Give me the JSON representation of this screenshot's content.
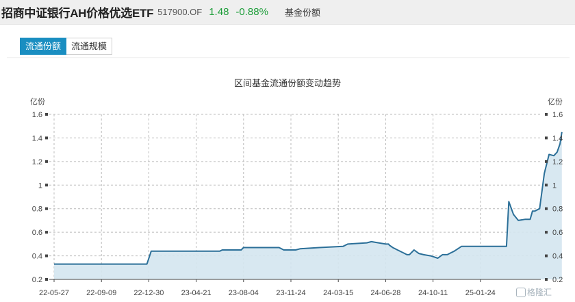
{
  "header": {
    "fund_name": "招商中证银行AH价格优选ETF",
    "fund_code": "517900.OF",
    "price": "1.48",
    "change": "-0.88%",
    "section_label": "基金份额"
  },
  "tabs": [
    {
      "label": "流通份额",
      "active": true
    },
    {
      "label": "流通规模",
      "active": false
    }
  ],
  "watermark": "格隆汇",
  "colors": {
    "accent": "#1a8ec1",
    "line": "#2b6f98",
    "area": "#d4e6ef",
    "up_down": "#1e9e3a"
  },
  "chart_data": {
    "type": "area",
    "title": "区间基金流通份额变动趋势",
    "y_unit_left": "亿份",
    "y_unit_right": "亿份",
    "ylim": [
      0.2,
      1.6
    ],
    "yticks": [
      "0.2",
      "0.4",
      "0.6",
      "0.8",
      "1",
      "1.2",
      "1.4",
      "1.6"
    ],
    "xticks": [
      "22-05-27",
      "22-09-09",
      "22-12-30",
      "23-04-21",
      "23-08-04",
      "23-11-24",
      "24-03-15",
      "24-06-28",
      "24-10-11",
      "25-01-24"
    ],
    "xlim_index": [
      0,
      10.7
    ],
    "grid": true,
    "series": [
      {
        "x": [
          0,
          0.95,
          1.96,
          2.05,
          3.5,
          3.55,
          3.95,
          4.0,
          4.75,
          4.85,
          5.1,
          5.2,
          5.6,
          6.1,
          6.2,
          6.6,
          6.7,
          7.0,
          7.06,
          7.08,
          7.15,
          7.25,
          7.4,
          7.45,
          7.5,
          7.6,
          7.7,
          7.8,
          7.95,
          8.1,
          8.2,
          8.3,
          8.35,
          8.45,
          8.6,
          8.65,
          8.75,
          8.85,
          8.95,
          9.05,
          9.1,
          9.2,
          9.25,
          9.3,
          9.4,
          9.5,
          9.55,
          9.6,
          9.7,
          9.8,
          9.95,
          10.05,
          10.1,
          10.15,
          10.25,
          10.35,
          10.45,
          10.55,
          10.62,
          10.68,
          10.72
        ],
        "y": [
          0.33,
          0.33,
          0.33,
          0.44,
          0.44,
          0.45,
          0.45,
          0.47,
          0.47,
          0.45,
          0.45,
          0.46,
          0.47,
          0.48,
          0.5,
          0.51,
          0.52,
          0.5,
          0.5,
          0.49,
          0.47,
          0.45,
          0.42,
          0.41,
          0.41,
          0.45,
          0.42,
          0.41,
          0.4,
          0.38,
          0.41,
          0.41,
          0.42,
          0.44,
          0.48,
          0.48,
          0.48,
          0.48,
          0.48,
          0.48,
          0.48,
          0.48,
          0.48,
          0.48,
          0.48,
          0.48,
          0.48,
          0.86,
          0.75,
          0.7,
          0.71,
          0.71,
          0.78,
          0.78,
          0.8,
          1.1,
          1.26,
          1.25,
          1.28,
          1.35,
          1.45
        ]
      }
    ]
  }
}
